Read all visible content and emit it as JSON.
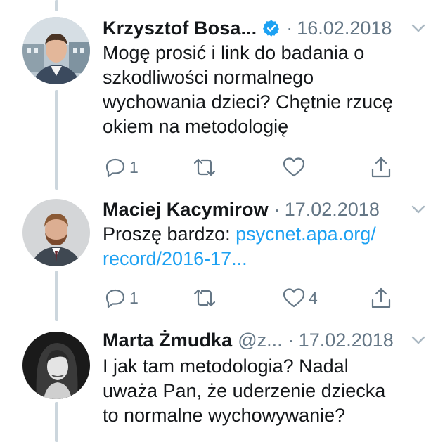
{
  "tweets": [
    {
      "author": "Krzysztof Bosa...",
      "handle": "",
      "verified": true,
      "date": "16.02.2018",
      "separator": "·",
      "text_lines": [
        "Mogę prosić i link do badania o",
        "szkodliwości normalnego",
        "wychowania dzieci? Chętnie rzucę",
        "okiem na metodologię"
      ],
      "reply_count": "1",
      "retweet_count": "",
      "like_count": ""
    },
    {
      "author": "Maciej Kacymirow",
      "handle": "",
      "verified": false,
      "date": "17.02.2018",
      "separator": "·",
      "text_prefix": "Proszę bardzo: ",
      "link_part1": "psycnet.apa.org/",
      "link_part2": "record/2016-17...",
      "reply_count": "1",
      "retweet_count": "",
      "like_count": "4"
    },
    {
      "author": "Marta Żmudka",
      "handle": "@z...",
      "verified": false,
      "date": "17.02.2018",
      "separator": "·",
      "text_lines": [
        "I jak tam metodologia? Nadal",
        "uważa Pan, że uderzenie dziecka",
        "to normalne wychowywanie?"
      ]
    }
  ],
  "colors": {
    "text": "#14171a",
    "secondary": "#657786",
    "link": "#1da1f2",
    "verified": "#1da1f2",
    "thread_line": "#ccd6dd"
  },
  "icons": [
    "verified-badge-icon",
    "chevron-down-icon",
    "reply-icon",
    "retweet-icon",
    "like-icon",
    "share-icon"
  ]
}
